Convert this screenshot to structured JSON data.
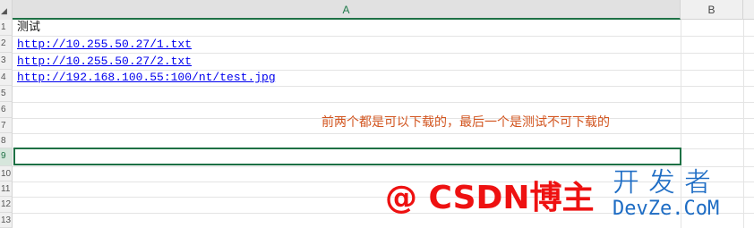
{
  "sheet": {
    "corner_mark": "◢",
    "columns": [
      "A",
      "B"
    ],
    "rows": [
      "1",
      "2",
      "3",
      "4",
      "5",
      "6",
      "7",
      "8",
      "9",
      "10",
      "11",
      "12",
      "13"
    ],
    "selected_row": "9"
  },
  "cells": {
    "A1": "测试",
    "A2": "http://10.255.50.27/1.txt",
    "A3": "http://10.255.50.27/2.txt",
    "A4": "http://192.168.100.55:100/nt/test.jpg"
  },
  "annotation": "前两个都是可以下载的，最后一个是测试不可下载的",
  "watermark": {
    "text": "@ CSDN博主",
    "logo_top": "开发者",
    "logo_bottom": "DevZe.CoM"
  },
  "colors": {
    "selection": "#1e7145",
    "annotation": "#d2541e",
    "watermark": "#ee1111",
    "link": "#0000ee",
    "logo": "#1d6cc4"
  }
}
